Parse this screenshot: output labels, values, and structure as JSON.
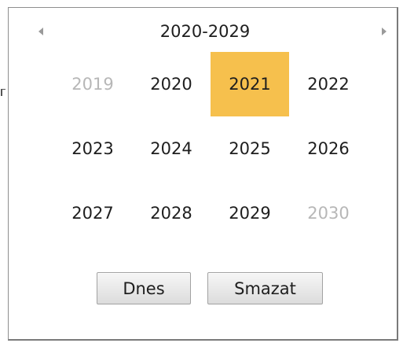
{
  "calendar": {
    "header_title": "2020-2029",
    "years": [
      [
        {
          "label": "2019",
          "state": "muted"
        },
        {
          "label": "2020",
          "state": "normal"
        },
        {
          "label": "2021",
          "state": "selected"
        },
        {
          "label": "2022",
          "state": "normal"
        }
      ],
      [
        {
          "label": "2023",
          "state": "normal"
        },
        {
          "label": "2024",
          "state": "normal"
        },
        {
          "label": "2025",
          "state": "normal"
        },
        {
          "label": "2026",
          "state": "normal"
        }
      ],
      [
        {
          "label": "2027",
          "state": "normal"
        },
        {
          "label": "2028",
          "state": "normal"
        },
        {
          "label": "2029",
          "state": "normal"
        },
        {
          "label": "2030",
          "state": "muted"
        }
      ]
    ],
    "buttons": {
      "today_label": "Dnes",
      "clear_label": "Smazat"
    },
    "icons": {
      "prev": "triangle-left-icon",
      "next": "triangle-right-icon"
    },
    "colors": {
      "selected_bg": "#f6c04d",
      "muted_text": "#b7b7b7",
      "text": "#1e1e1e",
      "arrow": "#9a9a9a"
    }
  }
}
